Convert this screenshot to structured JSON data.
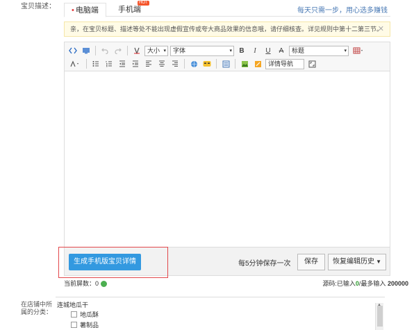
{
  "form": {
    "desc_label": "宝贝描述：",
    "category_label": "在店铺中所属的分类："
  },
  "tabs": [
    {
      "label": "电脑端",
      "active": true,
      "marker": "•"
    },
    {
      "label": "手机端",
      "active": false,
      "badge": "HOT"
    }
  ],
  "slogan": "每天只需一步，用心选多赚钱",
  "notice": {
    "text": "亲，在宝贝标题、描述等处不能出现虚假宣传或夸大商品效果的信息哦，请仔细核查。详见规则中第十二第三节。",
    "close": "✕"
  },
  "toolbar": {
    "size_select": "大小",
    "font_select": "字体",
    "heading_select": "标题",
    "nav_select": "详情导航",
    "bold": "B",
    "italic": "I",
    "underline": "U",
    "strike": "A"
  },
  "bottom": {
    "generate_button": "生成手机版宝贝详情",
    "autosave_text": "每5分钟保存一次",
    "save_button": "保存",
    "history_button": "恢复编辑历史"
  },
  "status": {
    "screens_label": "当前屏数：",
    "screens_value": "0",
    "counter_prefix": "源码:已输入",
    "counter_value": "0",
    "counter_sep": "/最多输入",
    "counter_max": "200000"
  },
  "category": {
    "title": "连城地瓜干",
    "items": [
      "地瓜酥",
      "薯制品"
    ]
  },
  "colors": {
    "accent": "#3399e0",
    "highlight": "#e2474b",
    "hot": "#f5552b",
    "notice_bg": "#fffbe6"
  }
}
